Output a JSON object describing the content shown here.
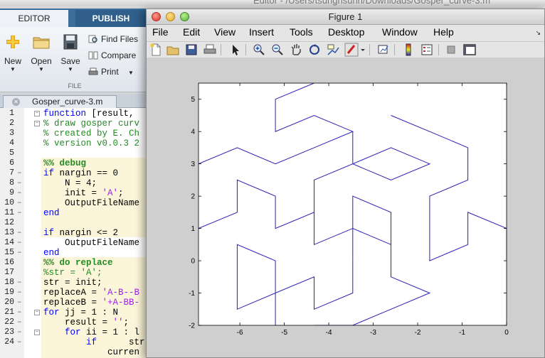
{
  "background_editor": {
    "window_title": "Editor - /Users/tsunghsuhn/Downloads/Gosper_curve-3.m",
    "tabs": [
      {
        "label": "EDITOR"
      },
      {
        "label": "PUBLISH"
      }
    ],
    "ribbon": {
      "new_label": "New",
      "open_label": "Open",
      "save_label": "Save",
      "find_files_label": "Find Files",
      "compare_label": "Compare",
      "print_label": "Print",
      "group_label": "FILE"
    },
    "file_tab": {
      "name": "Gosper_curve-3.m"
    },
    "code_lines": [
      {
        "n": "1",
        "text": "function [result,",
        "kind": "plain",
        "fold": true
      },
      {
        "n": "2",
        "text": "% draw gosper curv",
        "kind": "comment",
        "fold": true
      },
      {
        "n": "3",
        "text": "% created by E. Ch",
        "kind": "comment"
      },
      {
        "n": "4",
        "text": "% version v0.0.3 2",
        "kind": "comment"
      },
      {
        "n": "5",
        "text": "",
        "kind": "plain"
      },
      {
        "n": "6",
        "text": "%% debug",
        "kind": "cell"
      },
      {
        "n": "7",
        "text": "if nargin == 0",
        "kind": "plain"
      },
      {
        "n": "8",
        "text": "    N = 4;",
        "kind": "plain"
      },
      {
        "n": "9",
        "text": "    init = 'A';",
        "kind": "plain"
      },
      {
        "n": "10",
        "text": "    OutputFileName",
        "kind": "plain"
      },
      {
        "n": "11",
        "text": "end",
        "kind": "plain"
      },
      {
        "n": "12",
        "text": "",
        "kind": "plain"
      },
      {
        "n": "13",
        "text": "if nargin <= 2",
        "kind": "plain"
      },
      {
        "n": "14",
        "text": "    OutputFileName",
        "kind": "plain"
      },
      {
        "n": "15",
        "text": "end",
        "kind": "plain"
      },
      {
        "n": "16",
        "text": "%% do replace",
        "kind": "cell"
      },
      {
        "n": "17",
        "text": "%str = 'A';",
        "kind": "comment"
      },
      {
        "n": "18",
        "text": "str = init;",
        "kind": "plain"
      },
      {
        "n": "19",
        "text": "replaceA = 'A-B--B",
        "kind": "plain"
      },
      {
        "n": "20",
        "text": "replaceB = '+A-BB-",
        "kind": "plain"
      },
      {
        "n": "21",
        "text": "for jj = 1 : N",
        "kind": "plain",
        "fold": true
      },
      {
        "n": "22",
        "text": "    result = '';",
        "kind": "plain"
      },
      {
        "n": "23",
        "text": "    for ii = 1 : l",
        "kind": "plain",
        "fold": true
      },
      {
        "n": "24",
        "text": "        if      str",
        "kind": "plain"
      },
      {
        "n": "",
        "text": "            curren",
        "kind": "plain"
      }
    ],
    "dash_lines": [
      "7",
      "8",
      "9",
      "10",
      "11",
      "13",
      "14",
      "15",
      "18",
      "19",
      "20",
      "21",
      "22",
      "23",
      "24"
    ]
  },
  "figure": {
    "title": "Figure 1",
    "menu": [
      "File",
      "Edit",
      "View",
      "Insert",
      "Tools",
      "Desktop",
      "Window",
      "Help"
    ],
    "toolbar_icons": [
      "new-figure-icon",
      "open-file-icon",
      "save-icon",
      "print-icon",
      "pointer-icon",
      "zoom-in-icon",
      "zoom-out-icon",
      "pan-icon",
      "rotate-3d-icon",
      "data-cursor-icon",
      "brush-icon",
      "link-plot-icon",
      "colorbar-icon",
      "legend-icon",
      "hide-plot-tools-icon",
      "show-plot-tools-icon"
    ]
  },
  "chart_data": {
    "type": "line",
    "title": "",
    "xlabel": "",
    "ylabel": "",
    "xlim": [
      -6.93,
      0
    ],
    "ylim": [
      -2,
      5.5
    ],
    "xticks": [
      "-6",
      "-5",
      "-4",
      "-3",
      "-2",
      "-1",
      "0"
    ],
    "xtick_values": [
      -6,
      -5,
      -4,
      -3,
      -2,
      -1,
      0
    ],
    "yticks": [
      "-2",
      "-1",
      "0",
      "1",
      "2",
      "3",
      "4",
      "5"
    ],
    "ytick_values": [
      -2,
      -1,
      0,
      1,
      2,
      3,
      4,
      5
    ],
    "grid": false,
    "line_color": "#2b1fb5",
    "series": [
      {
        "points": [
          [
            -6.93,
            3
          ],
          [
            -6.06,
            3.5
          ],
          [
            -5.2,
            3
          ],
          [
            -4.33,
            3.5
          ],
          [
            -3.46,
            4
          ],
          [
            -4.33,
            4.5
          ],
          [
            -5.2,
            4
          ],
          [
            -5.2,
            5
          ],
          [
            -4.33,
            5.5
          ]
        ]
      },
      {
        "points": [
          [
            -6.93,
            1
          ],
          [
            -6.06,
            1.5
          ],
          [
            -6.06,
            2.5
          ],
          [
            -5.2,
            2
          ],
          [
            -5.2,
            1
          ],
          [
            -4.33,
            1.5
          ],
          [
            -4.33,
            0.5
          ],
          [
            -3.46,
            1
          ],
          [
            -3.46,
            0
          ]
        ]
      },
      {
        "points": [
          [
            -3.46,
            0
          ],
          [
            -3.46,
            -1
          ],
          [
            -4.33,
            -1.5
          ],
          [
            -4.33,
            -0.5
          ],
          [
            -5.2,
            -1
          ],
          [
            -5.2,
            0
          ],
          [
            -6.06,
            0.5
          ],
          [
            -6.06,
            -1.5
          ],
          [
            -5.2,
            -1
          ],
          [
            -5.2,
            -2
          ]
        ]
      },
      {
        "points": [
          [
            -4.33,
            -2
          ],
          [
            -3.46,
            -2
          ],
          [
            -2.6,
            -1.5
          ],
          [
            -1.73,
            -1
          ],
          [
            -2.6,
            -0.5
          ],
          [
            -2.6,
            0.5
          ],
          [
            -3.46,
            1
          ],
          [
            -3.46,
            2
          ],
          [
            -2.6,
            1.5
          ],
          [
            -2.6,
            0.5
          ]
        ]
      },
      {
        "points": [
          [
            -4.33,
            0.5
          ],
          [
            -4.33,
            2.5
          ],
          [
            -3.46,
            3
          ],
          [
            -2.6,
            2.5
          ],
          [
            -1.73,
            3
          ],
          [
            -2.6,
            3.5
          ],
          [
            -3.46,
            3
          ],
          [
            -3.46,
            4
          ]
        ]
      },
      {
        "points": [
          [
            -2.6,
            4.5
          ],
          [
            -1.73,
            4
          ],
          [
            -0.87,
            3.5
          ],
          [
            -0.87,
            2.5
          ],
          [
            -1.73,
            2
          ],
          [
            -1.73,
            0
          ],
          [
            -0.87,
            0.5
          ],
          [
            -0.87,
            1.5
          ],
          [
            0,
            1
          ],
          [
            0,
            0
          ]
        ]
      }
    ]
  }
}
